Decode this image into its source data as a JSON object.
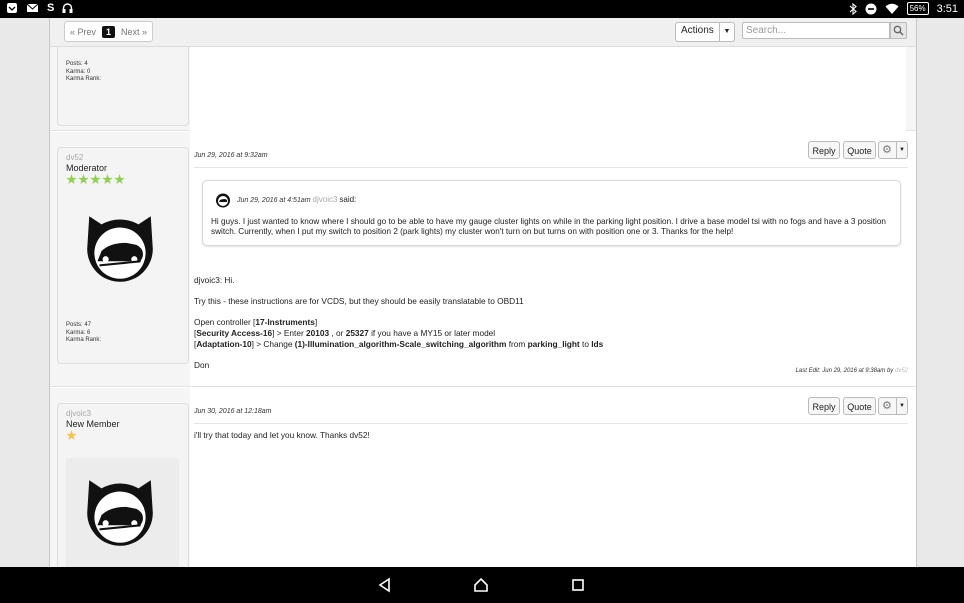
{
  "status_bar": {
    "battery": "56%",
    "time": "3:51",
    "icons": [
      "messages-icon",
      "mail-icon",
      "s-app-icon",
      "headphones-icon",
      "bluetooth-icon",
      "do-not-disturb-icon",
      "wifi-icon"
    ]
  },
  "toolbar": {
    "prev_label": "« Prev",
    "page_current": "1",
    "next_label": "Next »",
    "actions_label": "Actions",
    "search_placeholder": "Search..."
  },
  "posts": [
    {
      "stats": {
        "posts": "Posts: 4",
        "karma": "Karma: 0",
        "karma_rank": "Karma Rank:"
      }
    },
    {
      "username": "dv52",
      "role": "Moderator",
      "stars": 5,
      "star_color": "#8ed04d",
      "stats": {
        "posts": "Posts: 47",
        "karma": "Karma: 6",
        "karma_rank": "Karma Rank:"
      },
      "date": "Jun 29, 2016 at 9:32am",
      "reply_label": "Reply",
      "quote_label": "Quote",
      "quote": {
        "date": "Jun 29, 2016 at 4:51am",
        "user": "djvoic3",
        "said": "said:",
        "text": "Hi guys. I just wanted to know where I should go to be able to have my gauge cluster lights on while in the parking light position. I drive a base model tsi with no fogs and have a 3 position switch. Currently, when I put my switch to position 2 (park lights) my cluster won't turn on but turns on with position one or 3. Thanks for the help!"
      },
      "body": {
        "greeting": "djvoic3: Hi.",
        "line1": "Try this - these instructions are for VCDS, but they should be easily translatable to OBD11",
        "line2_a": "Open controller [",
        "line2_b": "17-Instruments",
        "line2_c": "]",
        "line3_a": "[",
        "line3_b": "Security Access-16",
        "line3_c": "] > Enter ",
        "line3_d": "20103",
        "line3_e": " , or ",
        "line3_f": "25327",
        "line3_g": " if you have a MY15 or later model",
        "line4_a": "[",
        "line4_b": "Adaptation-10",
        "line4_c": "] > Change ",
        "line4_d": "(1)-Illumination_algorithm-Scale_switching_algorithm",
        "line4_e": " from ",
        "line4_f": "parking_light",
        "line4_g": " to ",
        "line4_h": "lds",
        "signoff": "Don"
      },
      "last_edit": "Last Edit: Jun 29, 2016 at 9:38am by",
      "last_edit_by": "dv52"
    },
    {
      "username": "djvoic3",
      "role": "New Member",
      "stars": 1,
      "star_color": "#f4c247",
      "date": "Jun 30, 2016 at 12:18am",
      "reply_label": "Reply",
      "quote_label": "Quote",
      "body": "i'll try that today and let you know. Thanks dv52!"
    }
  ],
  "nav_bar": {
    "icons": [
      "back-icon",
      "home-icon",
      "recents-icon"
    ]
  }
}
